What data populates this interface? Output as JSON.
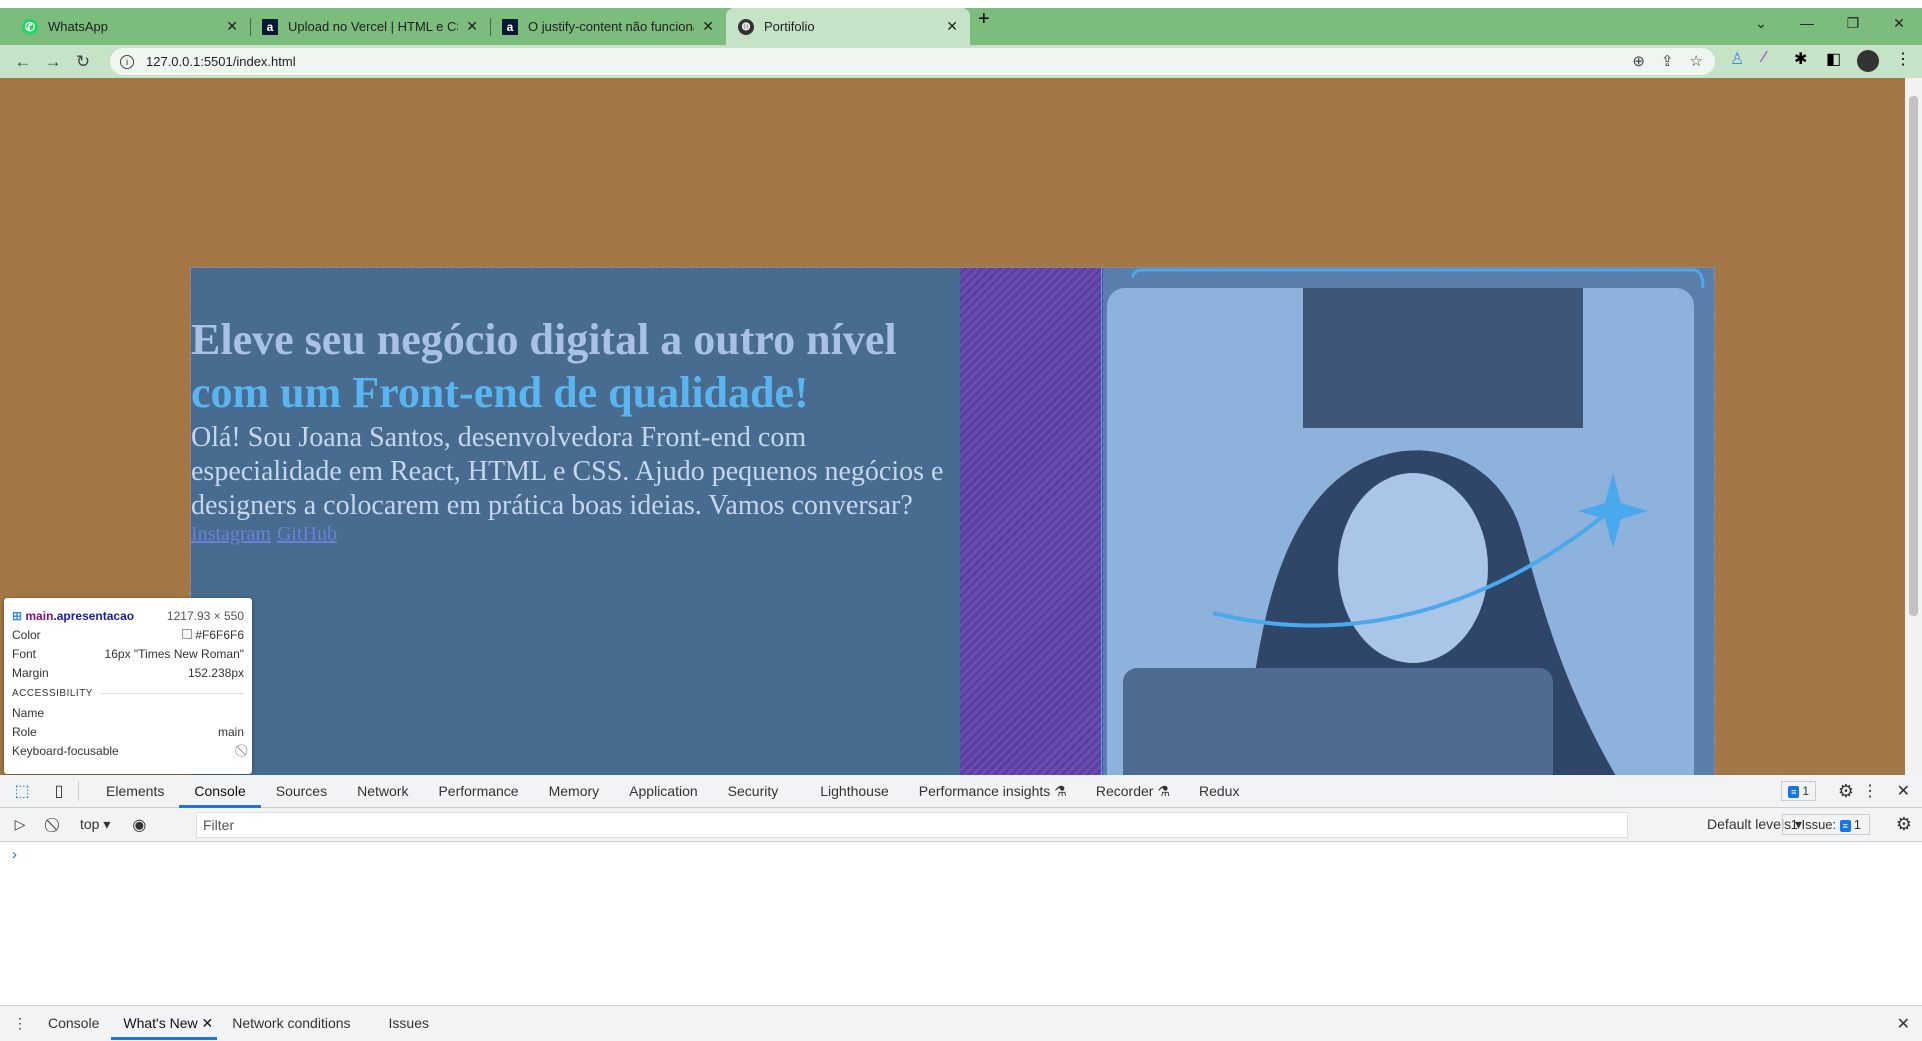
{
  "browser": {
    "tabs": [
      {
        "title": "WhatsApp",
        "icon": "whatsapp-icon"
      },
      {
        "title": "Upload no Vercel | HTML e CSS: t",
        "icon": "alura-icon"
      },
      {
        "title": "O justify-content não funciona | H",
        "icon": "alura-icon"
      },
      {
        "title": "Portifolio",
        "icon": "globe-icon",
        "active": true
      }
    ],
    "url": "127.0.0.1:5501/index.html",
    "colors": {
      "tabbar": "#7cbd7e",
      "toolbar": "#c6e3c7"
    }
  },
  "page": {
    "background": "#a47746",
    "heading_line1": "Eleve seu negócio digital a outro nível",
    "heading_line2": "com um Front-end de qualidade!",
    "intro": "Olá! Sou Joana Santos, desenvolvedora Front-end com especialidade em React, HTML e CSS. Ajudo pequenos negócios e designers a colocarem em prática boas ideias. Vamos conversar?",
    "links": [
      "Instagram",
      "GitHub"
    ]
  },
  "inspector_tooltip": {
    "selector_tag": "main",
    "selector_class": ".apresentacao",
    "size": "1217.93 × 550",
    "rows": [
      {
        "label": "Color",
        "value": "#F6F6F6"
      },
      {
        "label": "Font",
        "value": "16px \"Times New Roman\""
      },
      {
        "label": "Margin",
        "value": "152.238px"
      }
    ],
    "accessibility_title": "ACCESSIBILITY",
    "acc_rows": [
      {
        "label": "Name",
        "value": ""
      },
      {
        "label": "Role",
        "value": "main"
      },
      {
        "label": "Keyboard-focusable",
        "value": ""
      }
    ]
  },
  "devtools": {
    "tabs": [
      "Elements",
      "Console",
      "Sources",
      "Network",
      "Performance",
      "Memory",
      "Application",
      "Security",
      "Lighthouse",
      "Performance insights",
      "Recorder",
      "Redux"
    ],
    "active_tab": "Console",
    "messages_badge": "1",
    "context": "top",
    "filter_placeholder": "Filter",
    "levels": "Default levels",
    "issues": "1 Issue:",
    "issues_count": "1",
    "drawer_tabs": [
      "Console",
      "What's New",
      "Network conditions",
      "Issues"
    ],
    "active_drawer_tab": "What's New"
  }
}
